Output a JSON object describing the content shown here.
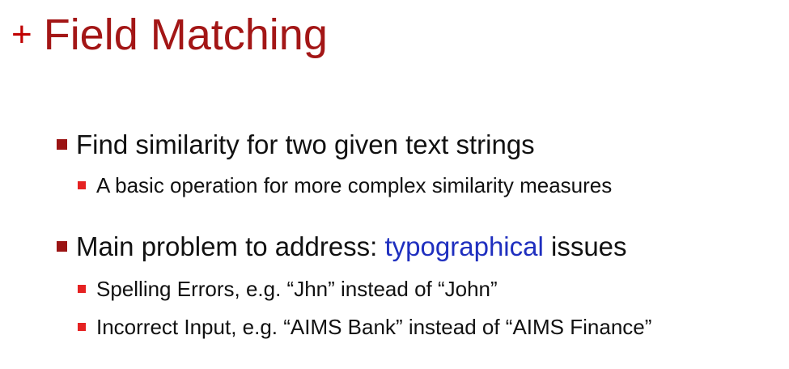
{
  "title": {
    "plus": "+",
    "text": "Field Matching"
  },
  "bullets": [
    {
      "text": "Find similarity for two given text strings",
      "sub": [
        "A basic operation for more complex similarity measures"
      ]
    },
    {
      "prefix": "Main problem to address: ",
      "highlight": "typographical",
      "suffix": " issues",
      "sub": [
        "Spelling Errors, e.g. “Jhn” instead of “John”",
        "Incorrect Input, e.g. “AIMS Bank” instead of “AIMS Finance”"
      ]
    }
  ],
  "colors": {
    "title": "#a31616",
    "title_plus": "#c00000",
    "bullet_level1": "#9b1414",
    "bullet_level2": "#e52222",
    "highlight": "#1f2fbf",
    "text": "#111111",
    "background": "#ffffff"
  }
}
